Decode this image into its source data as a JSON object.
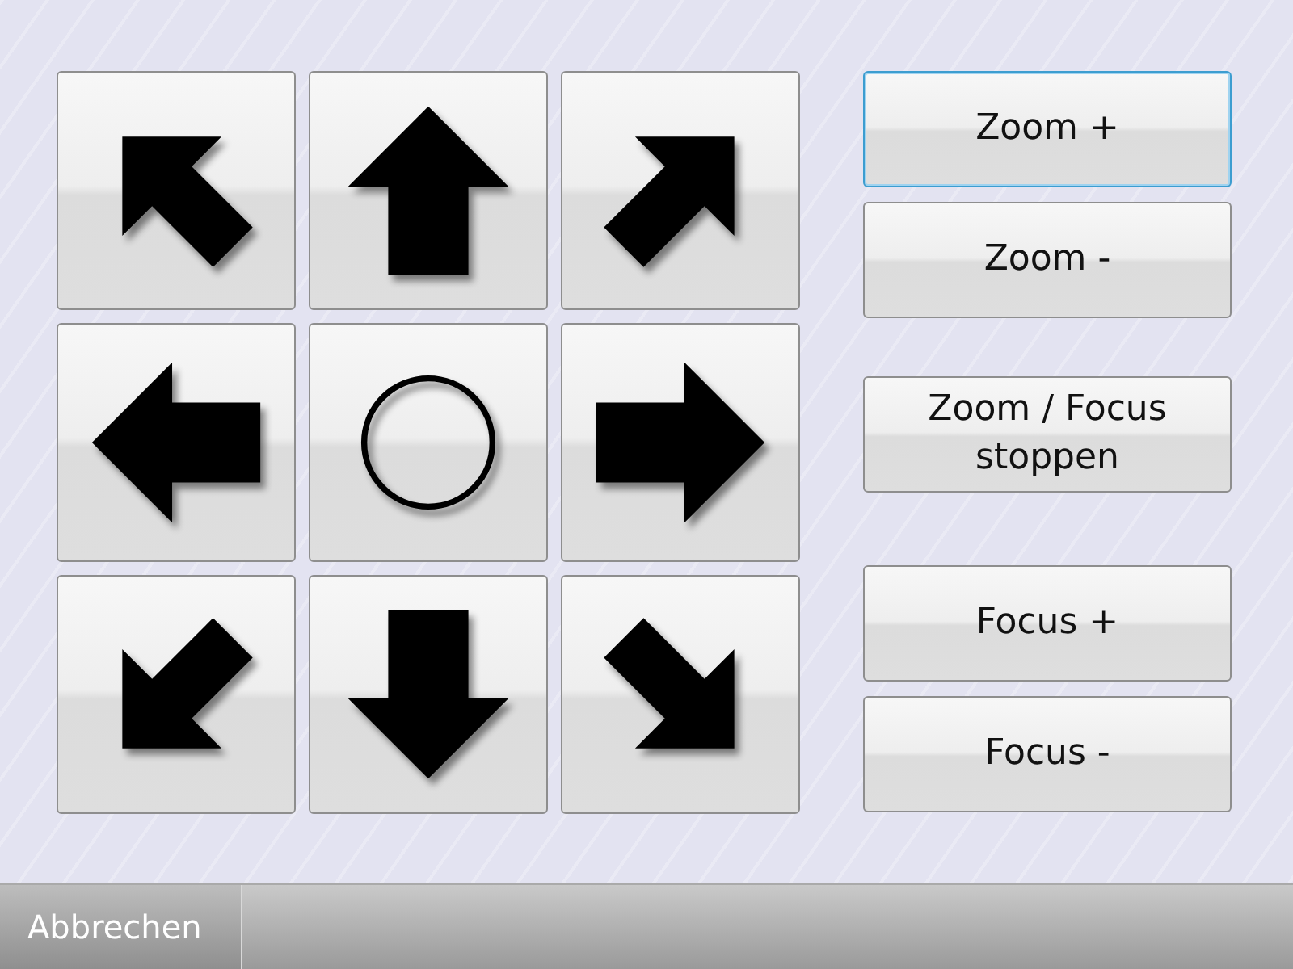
{
  "pad": [
    {
      "kind": "up-left"
    },
    {
      "kind": "up"
    },
    {
      "kind": "up-right"
    },
    {
      "kind": "left"
    },
    {
      "kind": "center"
    },
    {
      "kind": "right"
    },
    {
      "kind": "down-left"
    },
    {
      "kind": "down"
    },
    {
      "kind": "down-right"
    }
  ],
  "button_groups": [
    {
      "buttons": [
        {
          "label": "Zoom +",
          "focused": true
        },
        {
          "label": "Zoom -",
          "focused": false
        }
      ]
    },
    {
      "buttons": [
        {
          "label": "Zoom / Focus stoppen",
          "focused": false
        }
      ]
    },
    {
      "buttons": [
        {
          "label": "Focus +",
          "focused": false
        },
        {
          "label": "Focus -",
          "focused": false
        }
      ]
    }
  ],
  "bottom_bar": {
    "cancel": "Abbrechen"
  }
}
